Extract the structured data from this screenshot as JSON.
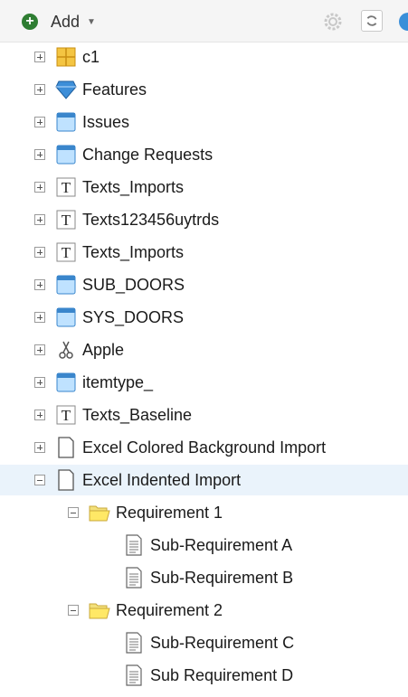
{
  "toolbar": {
    "add_label": "Add",
    "add_icon": "add-circle-icon",
    "caret_icon": "caret-down-icon",
    "settings_icon": "gear-icon",
    "refresh_icon": "refresh-icon",
    "accent_color": "#2e7d32"
  },
  "tree": {
    "items": [
      {
        "label": "c1",
        "icon": "grid-icon",
        "expanded": false
      },
      {
        "label": "Features",
        "icon": "diamond-icon",
        "expanded": false
      },
      {
        "label": "Issues",
        "icon": "window-icon",
        "expanded": false
      },
      {
        "label": "Change Requests",
        "icon": "window-icon",
        "expanded": false
      },
      {
        "label": "Texts_Imports",
        "icon": "text-icon",
        "expanded": false
      },
      {
        "label": "Texts123456uytrds",
        "icon": "text-icon",
        "expanded": false
      },
      {
        "label": "Texts_Imports",
        "icon": "text-icon",
        "expanded": false
      },
      {
        "label": "SUB_DOORS",
        "icon": "window-icon",
        "expanded": false
      },
      {
        "label": "SYS_DOORS",
        "icon": "window-icon",
        "expanded": false
      },
      {
        "label": "Apple",
        "icon": "scissors-icon",
        "expanded": false
      },
      {
        "label": "itemtype_",
        "icon": "window-icon",
        "expanded": false
      },
      {
        "label": "Texts_Baseline",
        "icon": "text-icon",
        "expanded": false
      },
      {
        "label": "Excel Colored Background Import",
        "icon": "document-icon",
        "expanded": false
      },
      {
        "label": "Excel Indented Import",
        "icon": "document-icon",
        "expanded": true,
        "selected": true,
        "children": [
          {
            "label": "Requirement 1",
            "icon": "folder-open-icon",
            "expanded": true,
            "children": [
              {
                "label": "Sub-Requirement A",
                "icon": "text-document-icon"
              },
              {
                "label": "Sub-Requirement B",
                "icon": "text-document-icon"
              }
            ]
          },
          {
            "label": "Requirement 2",
            "icon": "folder-open-icon",
            "expanded": true,
            "children": [
              {
                "label": "Sub-Requirement C",
                "icon": "text-document-icon"
              },
              {
                "label": "Sub Requirement D",
                "icon": "text-document-icon"
              }
            ]
          }
        ]
      }
    ]
  }
}
